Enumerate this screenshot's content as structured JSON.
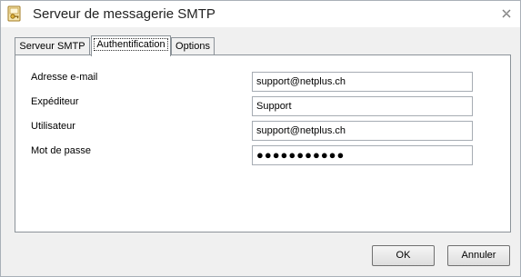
{
  "window": {
    "title": "Serveur de messagerie SMTP"
  },
  "icons": {
    "app": "envelope-key-icon",
    "close": "close-icon"
  },
  "tabs": [
    {
      "label": "Serveur SMTP",
      "active": false
    },
    {
      "label": "Authentification",
      "active": true
    },
    {
      "label": "Options",
      "active": false
    }
  ],
  "form": {
    "email_label": "Adresse e-mail",
    "email_value": "support@netplus.ch",
    "sender_label": "Expéditeur",
    "sender_value": "Support",
    "user_label": "Utilisateur",
    "user_value": "support@netplus.ch",
    "password_label": "Mot de passe",
    "password_value": "●●●●●●●●●●●"
  },
  "buttons": {
    "ok": "OK",
    "cancel": "Annuler"
  }
}
